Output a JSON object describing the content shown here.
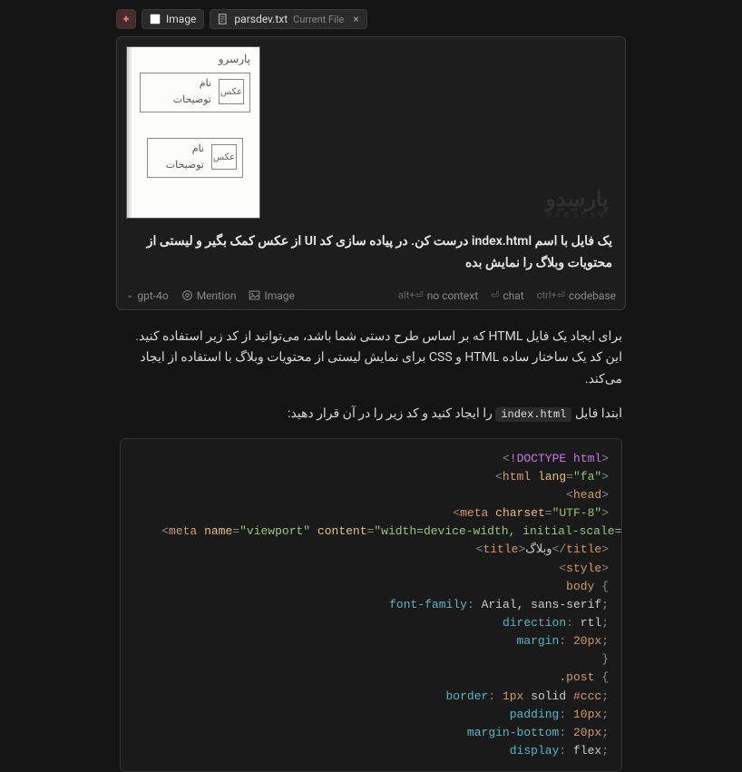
{
  "tabs": {
    "image_label": "Image",
    "file_name": "parsdev.txt",
    "file_sub": "Current File"
  },
  "sketch": {
    "heading": "پارسرو",
    "thumb": "عکس",
    "title": "نام",
    "desc": "توضیحات"
  },
  "prompt": "یک فایل با اسم index.html درست کن. در پیاده سازی کد UI از عکس کمک بگیر و لیستی از محتویات وبلاگ را نمایش بده",
  "footer": {
    "model": "gpt-4o",
    "mention": "Mention",
    "image": "Image",
    "nocontext_kbd": "alt+⏎",
    "nocontext": "no context",
    "chat_kbd": "⏎",
    "chat": "chat",
    "codebase_kbd": "ctrl+⏎",
    "codebase": "codebase"
  },
  "reply": {
    "p1": "برای ایجاد یک فایل HTML که بر اساس طرح دستی شما باشد، می‌توانید از کد زیر استفاده کنید. این کد یک ساختار ساده HTML و CSS برای نمایش لیستی از محتویات وبلاگ با استفاده از ایجاد می‌کند.",
    "p2_pre": "ابتدا فایل ",
    "p2_code": "index.html",
    "p2_post": " را ایجاد کنید و کد زیر را در آن قرار دهید:"
  },
  "code": {
    "title_text": "وبلاگ"
  },
  "watermark": {
    "fa": "پارسِدِو",
    "en": "PARSDEV"
  }
}
